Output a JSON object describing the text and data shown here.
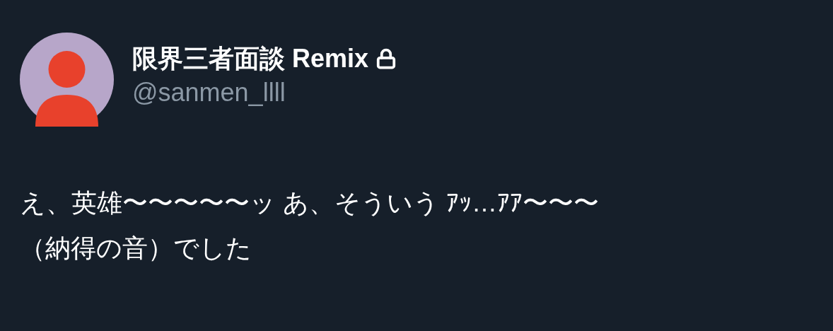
{
  "author": {
    "name": "限界三者面談 Remix",
    "protected": true,
    "handle": "@sanmen_llll"
  },
  "tweet": {
    "lines": [
      "え、英雄〜〜〜〜〜ッ あ、そういう ｱｯ…ｱｱ〜〜〜",
      "（納得の音）でした"
    ]
  }
}
